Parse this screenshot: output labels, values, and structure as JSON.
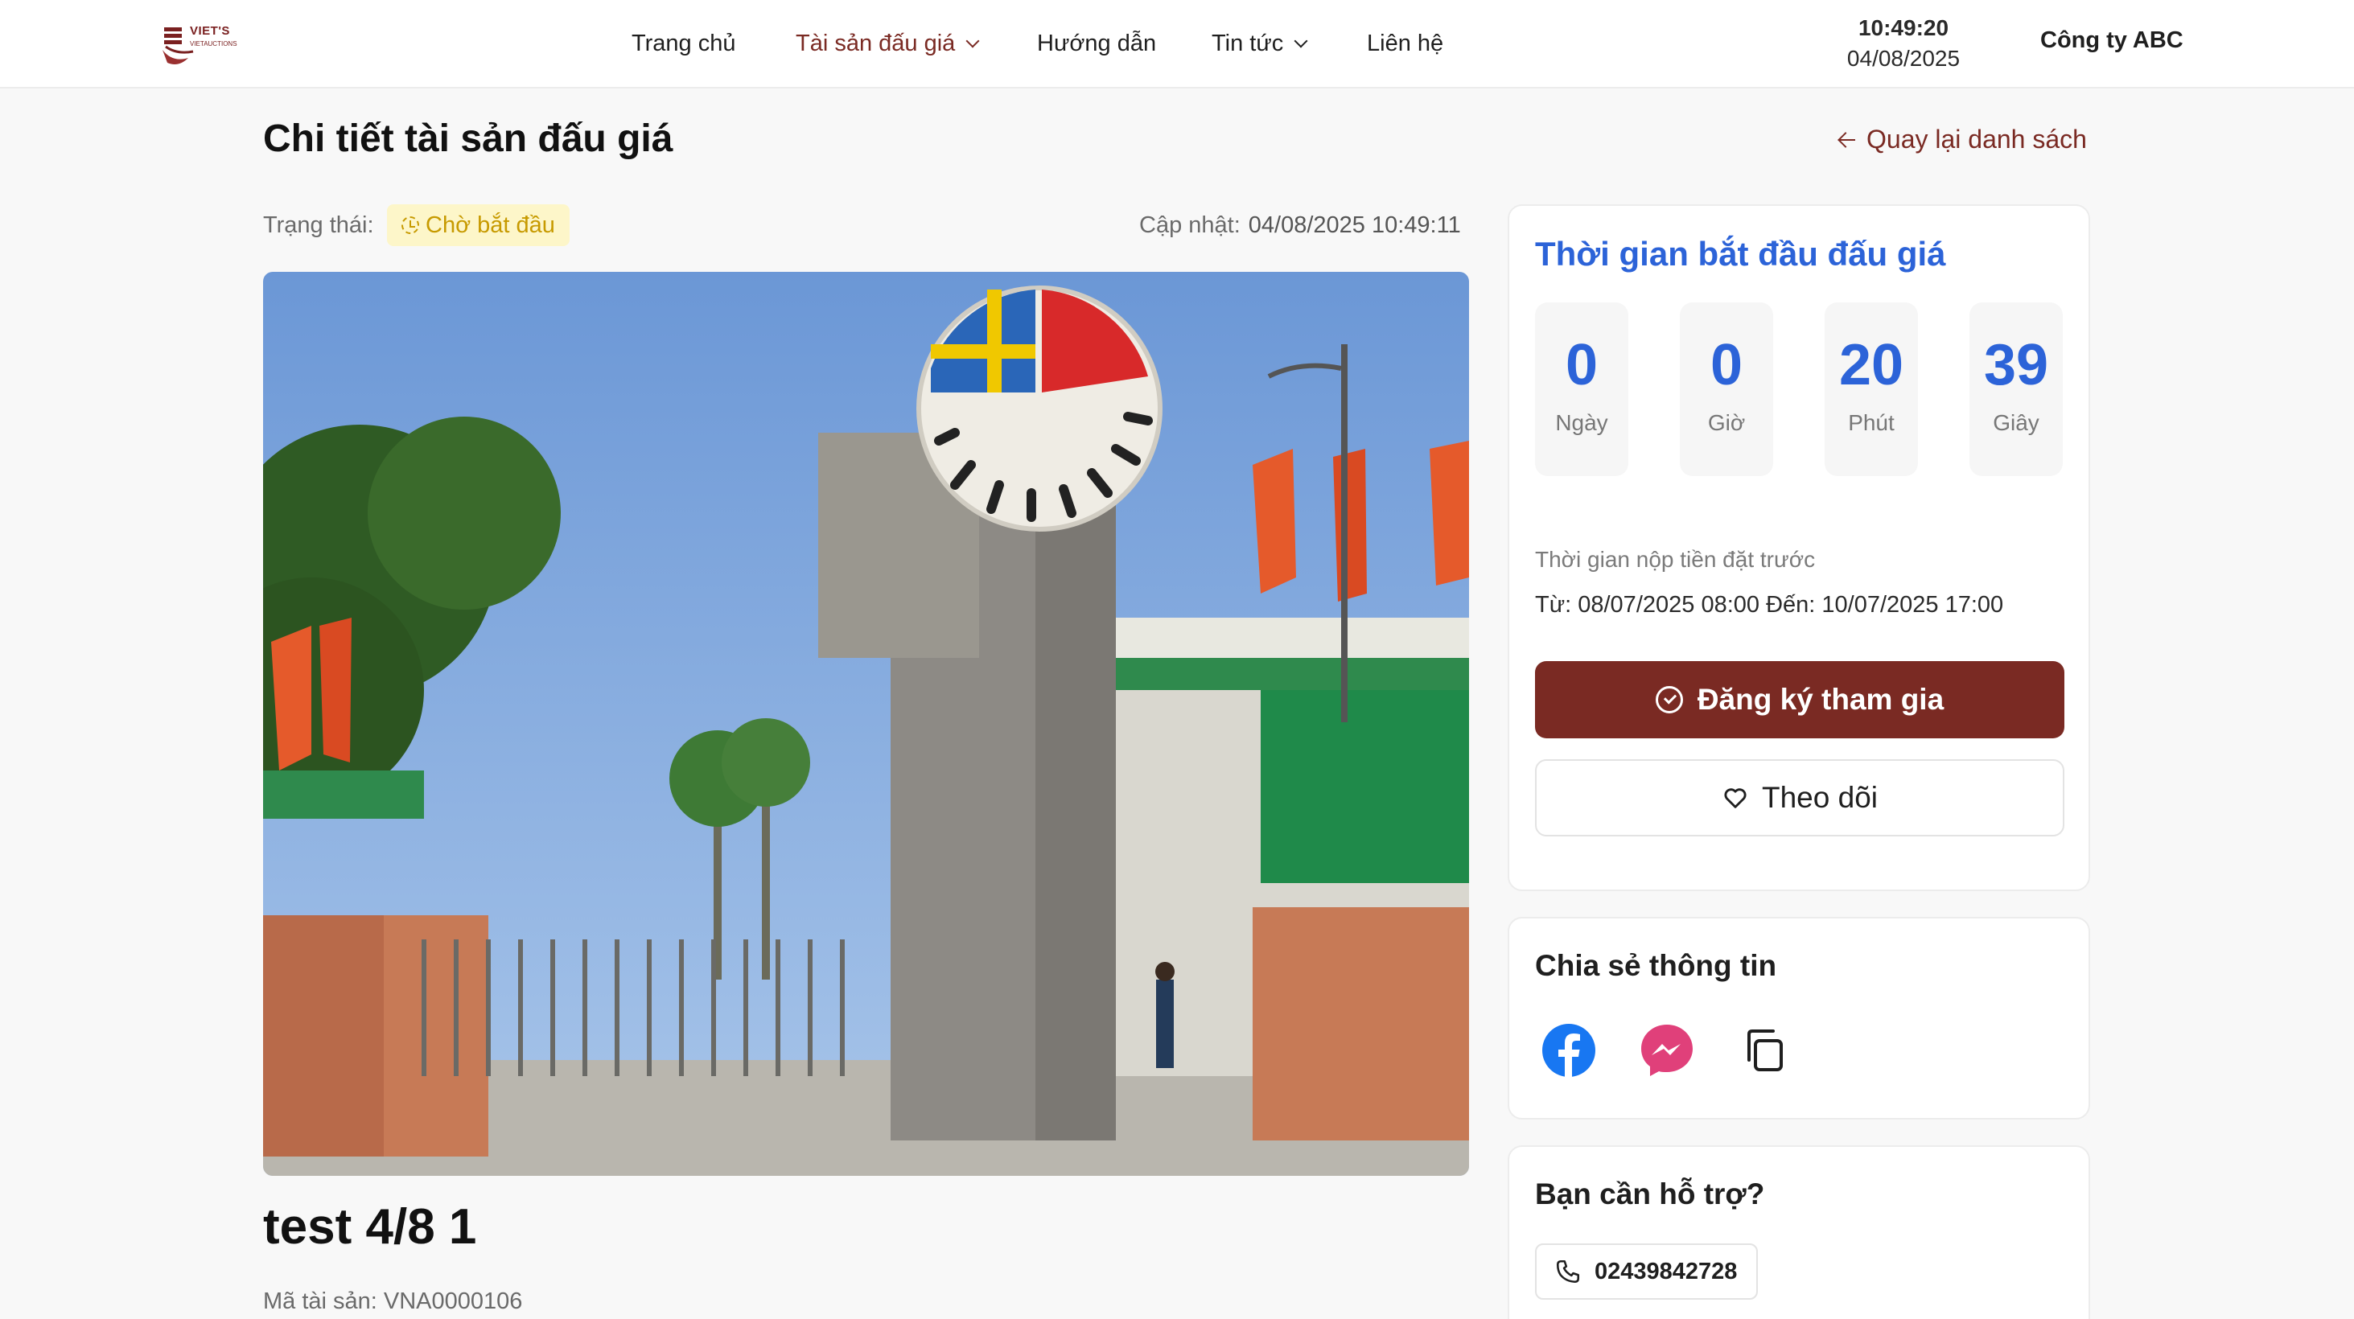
{
  "header": {
    "logo": {
      "brand": "VIET'S",
      "sub": "VIETAUCTIONS"
    },
    "nav": [
      {
        "label": "Trang chủ"
      },
      {
        "label": "Tài sản đấu giá"
      },
      {
        "label": "Hướng dẫn"
      },
      {
        "label": "Tin tức"
      },
      {
        "label": "Liên hệ"
      }
    ],
    "clock": {
      "time": "10:49:20",
      "date": "04/08/2025"
    },
    "company": "Công ty ABC"
  },
  "page": {
    "title": "Chi tiết tài sản đấu giá",
    "back_label": "Quay lại danh sách"
  },
  "status": {
    "label": "Trạng thái:",
    "badge": "Chờ bắt đầu",
    "updated_label": "Cập nhật:",
    "updated_value": "04/08/2025 10:49:11"
  },
  "asset": {
    "name": "test 4/8 1",
    "code": "Mã tài sản: VNA0000106"
  },
  "countdown": {
    "title": "Thời gian bắt đầu đấu giá",
    "units": [
      {
        "value": "0",
        "label": "Ngày"
      },
      {
        "value": "0",
        "label": "Giờ"
      },
      {
        "value": "20",
        "label": "Phút"
      },
      {
        "value": "39",
        "label": "Giây"
      }
    ],
    "deposit_label": "Thời gian nộp tiền đặt trước",
    "deposit_range": "Từ: 08/07/2025 08:00 Đến: 10/07/2025 17:00",
    "register_label": "Đăng ký tham gia",
    "follow_label": "Theo dõi"
  },
  "share": {
    "title": "Chia sẻ thông tin",
    "icons": [
      "facebook-icon",
      "messenger-icon",
      "copy-icon"
    ]
  },
  "support": {
    "title": "Bạn cần hỗ trợ?",
    "phone": "02439842728"
  },
  "colors": {
    "accent": "#7a2a23",
    "countdown_blue": "#2c63d8",
    "badge_bg": "#fdf6c9",
    "badge_text": "#c79a00"
  }
}
